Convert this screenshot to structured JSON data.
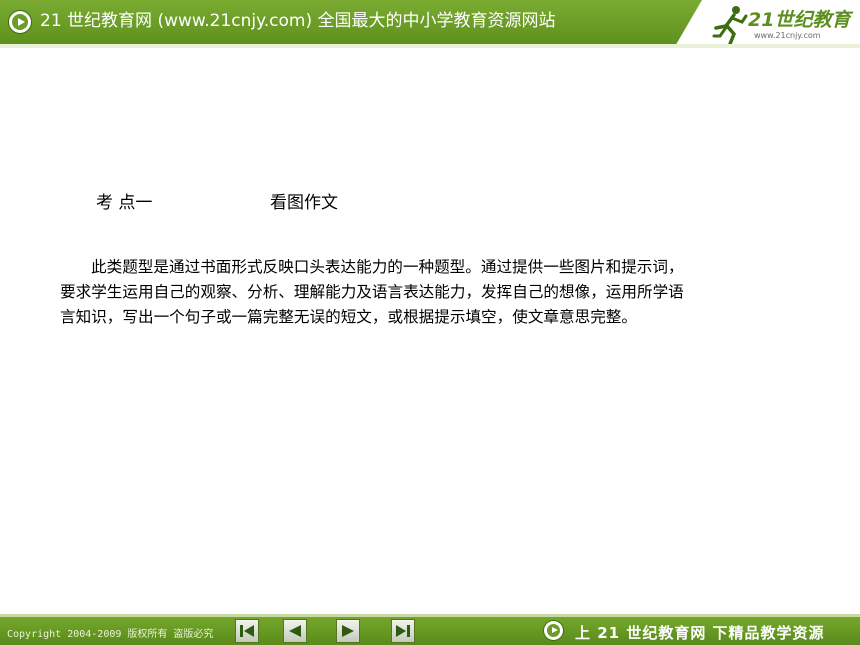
{
  "header": {
    "title": "21 世纪教育网 (www.21cnjy.com)  全国最大的中小学教育资源网站",
    "logo_text": "21世纪教育",
    "logo_url": "www.21cnjy.com"
  },
  "content": {
    "kaodian": "考 点一",
    "topic": "看图作文",
    "paragraph_lines": [
      "此类题型是通过书面形式反映口头表达能力的一种题型。通过提供一些图片和提示词，",
      "要求学生运用自己的观察、分析、理解能力及语言表达能力，发挥自己的想像，运用所学语",
      "言知识，写出一个句子或一篇完整无误的短文，或根据提示填空，使文章意思完整。"
    ]
  },
  "footer": {
    "copyright": "Copyright 2004-2009 版权所有 盗版必究",
    "slogan": "上 21 世纪教育网   下精品教学资源",
    "nav_icons": [
      "first-slide-icon",
      "prev-slide-icon",
      "next-slide-icon",
      "last-slide-icon"
    ]
  },
  "colors": {
    "banner_green": "#6b9b28",
    "nav_button_gray": "#c3c9bc"
  }
}
